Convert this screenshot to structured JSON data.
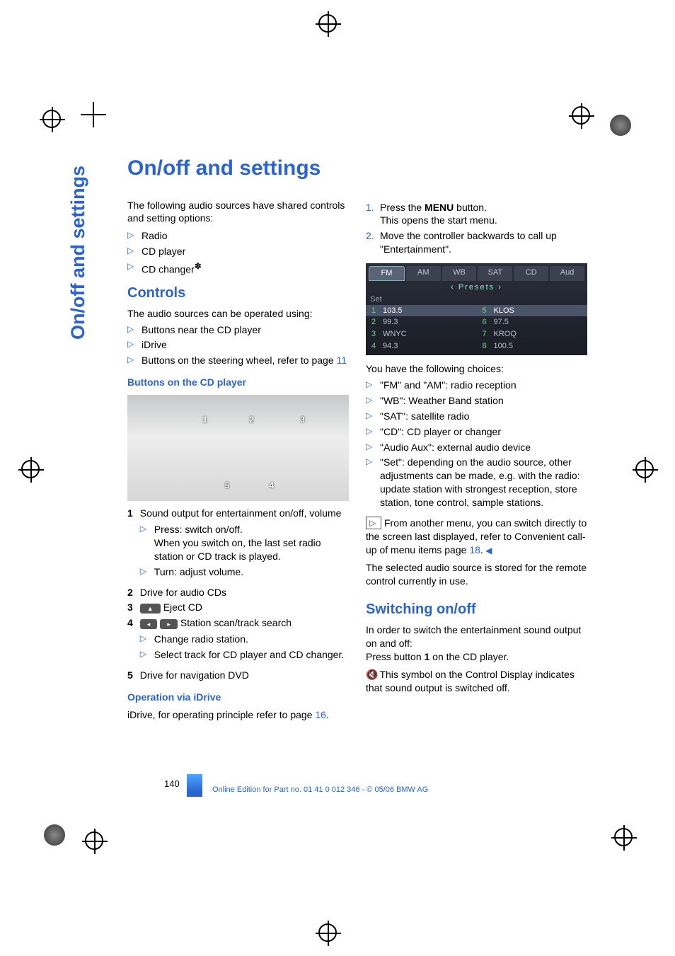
{
  "side_tab": "On/off and settings",
  "title": "On/off and settings",
  "left": {
    "intro": "The following audio sources have shared controls and setting options:",
    "sources": [
      "Radio",
      "CD player",
      "CD changer"
    ],
    "controls_h": "Controls",
    "controls_intro": "The audio sources can be operated using:",
    "controls_list": [
      "Buttons near the CD player",
      "iDrive",
      "Buttons on the steering wheel, refer to page "
    ],
    "controls_page_ref": "11",
    "buttons_h": "Buttons on the CD player",
    "cd_callouts": {
      "1": "1",
      "2": "2",
      "3": "3",
      "4": "4",
      "5": "5"
    },
    "def1_n": "1",
    "def1": "Sound output for entertainment on/off, volume",
    "def1_sub": [
      "Press: switch on/off.\nWhen you switch on, the last set radio station or CD track is played.",
      "Turn: adjust volume."
    ],
    "def2_n": "2",
    "def2": "Drive for audio CDs",
    "def3_n": "3",
    "def3_btn": "▲",
    "def3": "Eject CD",
    "def4_n": "4",
    "def4_btn_l": "◂",
    "def4_btn_r": "▸",
    "def4": "Station scan/track search",
    "def4_sub": [
      "Change radio station.",
      "Select track for CD player and CD changer."
    ],
    "def5_n": "5",
    "def5": "Drive for navigation DVD",
    "idrive_h": "Operation via iDrive",
    "idrive_txt": "iDrive, for operating principle refer to page ",
    "idrive_ref": "16"
  },
  "right": {
    "steps": [
      {
        "pre": "Press the ",
        "bold": "MENU",
        "post": " button.\nThis opens the start menu."
      },
      {
        "txt": "Move the controller backwards to call up \"Entertainment\"."
      }
    ],
    "ui": {
      "tabs": [
        "FM",
        "AM",
        "WB",
        "SAT",
        "CD",
        "Aud"
      ],
      "presets_label": "‹  Presets  ›",
      "set_label": "Set",
      "presets": [
        {
          "n": "1",
          "t": "103.5",
          "hi": true
        },
        {
          "n": "5",
          "t": "KLOS",
          "hi": true
        },
        {
          "n": "2",
          "t": "99.3"
        },
        {
          "n": "6",
          "t": "97.5"
        },
        {
          "n": "3",
          "t": "WNYC"
        },
        {
          "n": "7",
          "t": "KROQ"
        },
        {
          "n": "4",
          "t": "94.3"
        },
        {
          "n": "8",
          "t": "100.5"
        }
      ]
    },
    "choices_intro": "You have the following choices:",
    "choices": [
      "\"FM\" and \"AM\": radio reception",
      "\"WB\": Weather Band station",
      "\"SAT\": satellite radio",
      "\"CD\": CD player or changer",
      "\"Audio Aux\": external audio device",
      "\"Set\": depending on the audio source, other adjustments can be made, e.g. with the radio: update station with strongest reception, store station, tone control, sample stations."
    ],
    "note": "From another menu, you can switch directly to the screen last displayed, refer to Convenient call-up of menu items page ",
    "note_ref": "18",
    "stored": "The selected audio source is stored for the remote control currently in use.",
    "switch_h": "Switching on/off",
    "switch_intro": "In order to switch the entertainment sound output on and off:",
    "switch_press_pre": "Press button ",
    "switch_press_bold": "1",
    "switch_press_post": " on the CD player.",
    "mute": "This symbol on the Control Display indicates that sound output is switched off."
  },
  "page_num": "140",
  "footer": "Online Edition for Part no. 01 41 0 012 346 - © 05/06 BMW AG"
}
